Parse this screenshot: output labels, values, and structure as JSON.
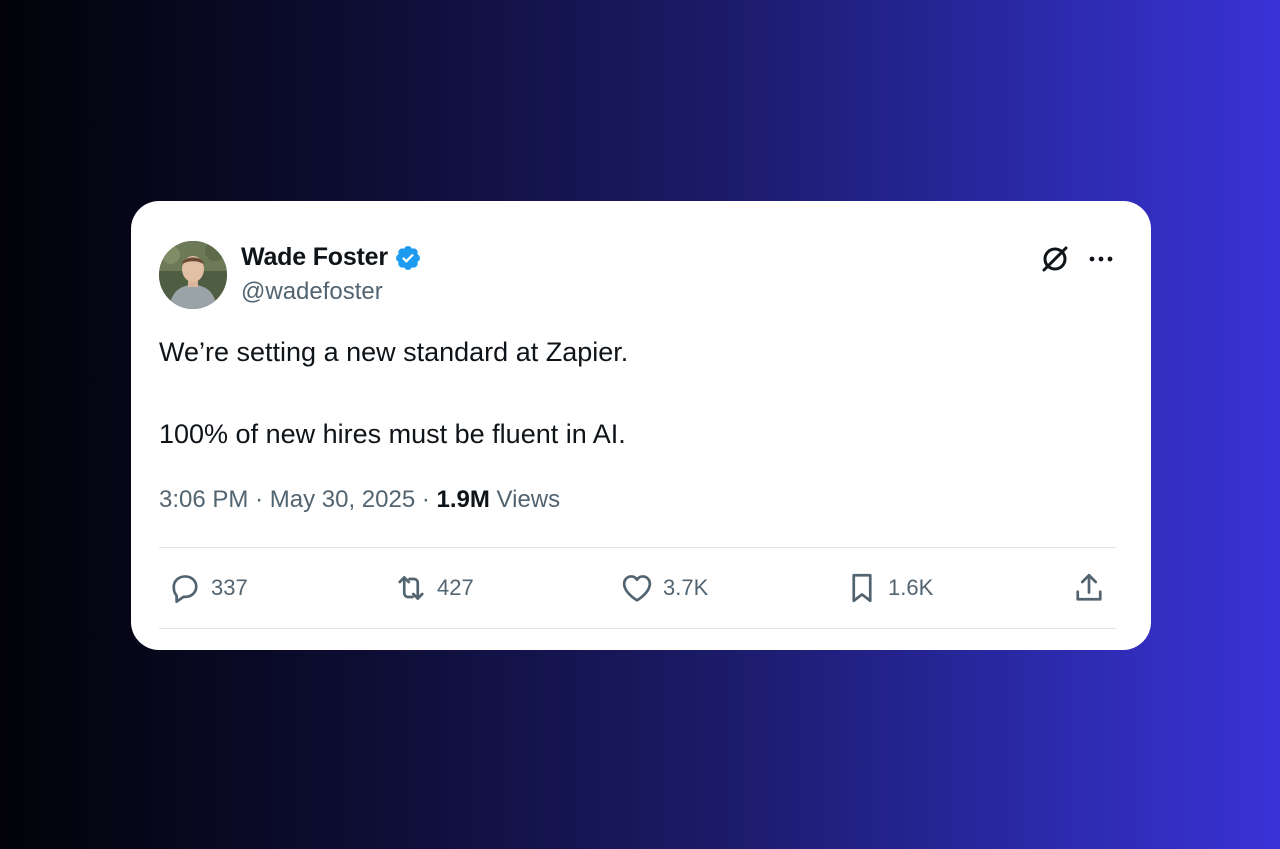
{
  "tweet": {
    "author_name": "Wade Foster",
    "author_handle": "@wadefoster",
    "verified": true,
    "lines": [
      "We’re setting a new standard at Zapier.",
      "100% of new hires must be fluent in AI."
    ],
    "time": "3:06 PM",
    "separator": "·",
    "date": "May 30, 2025",
    "views_count": "1.9M",
    "views_label": "Views"
  },
  "actions": {
    "replies": "337",
    "retweets": "427",
    "likes": "3.7K",
    "bookmarks": "1.6K"
  },
  "icons": {
    "verified": "verified-badge-icon",
    "grok": "grok-icon",
    "more": "more-icon",
    "reply": "reply-icon",
    "retweet": "retweet-icon",
    "like": "heart-icon",
    "bookmark": "bookmark-icon",
    "share": "share-icon"
  },
  "colors": {
    "verified_blue": "#1d9bf0",
    "text_primary": "#0f1419",
    "text_secondary": "#536471",
    "background_gradient_start": "#020208",
    "background_gradient_end": "#3a32d6"
  }
}
